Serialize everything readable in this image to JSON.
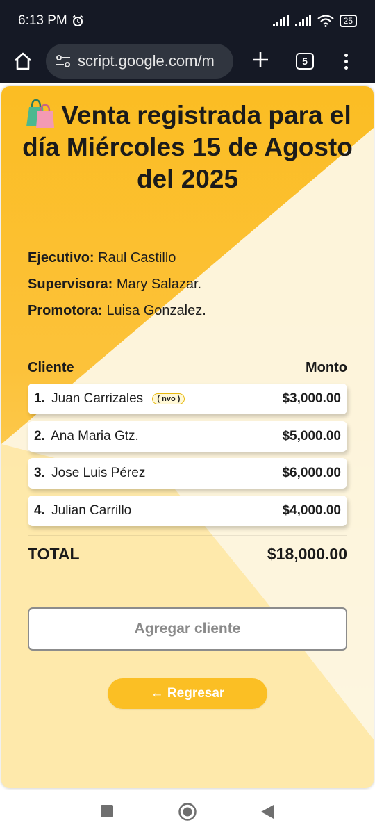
{
  "status_bar": {
    "time": "6:13 PM",
    "battery": "25"
  },
  "browser": {
    "url": "script.google.com/m",
    "tab_count": "5"
  },
  "page": {
    "title": "Venta registrada para el día Miércoles 15 de Agosto del 2025",
    "info": [
      {
        "label": "Ejecutivo:",
        "value": "Raul Castillo"
      },
      {
        "label": "Supervisora:",
        "value": "Mary Salazar."
      },
      {
        "label": "Promotora:",
        "value": "Luisa Gonzalez."
      }
    ],
    "table": {
      "client_header": "Cliente",
      "amount_header": "Monto",
      "rows": [
        {
          "num": "1.",
          "name": "Juan Carrizales",
          "badge": "( nvo )",
          "amount": "$3,000.00"
        },
        {
          "num": "2.",
          "name": "Ana Maria Gtz.",
          "badge": "",
          "amount": "$5,000.00"
        },
        {
          "num": "3.",
          "name": "Jose Luis Pérez",
          "badge": "",
          "amount": "$6,000.00"
        },
        {
          "num": "4.",
          "name": "Julian Carrillo",
          "badge": "",
          "amount": "$4,000.00"
        }
      ]
    },
    "total_label": "TOTAL",
    "total_value": "$18,000.00",
    "add_button": "Agregar cliente",
    "back_button": "← Regresar"
  },
  "colors": {
    "accent": "#fbbf24",
    "status_bar_bg": "#151925"
  },
  "icons": {
    "title_icon": "shopping-bags-icon",
    "home": "home-icon",
    "site_settings": "tune-icon",
    "new_tab": "plus-icon",
    "menu": "more-vert-icon",
    "nav_recents": "square-icon",
    "nav_home": "circle-icon",
    "nav_back": "triangle-back-icon"
  }
}
